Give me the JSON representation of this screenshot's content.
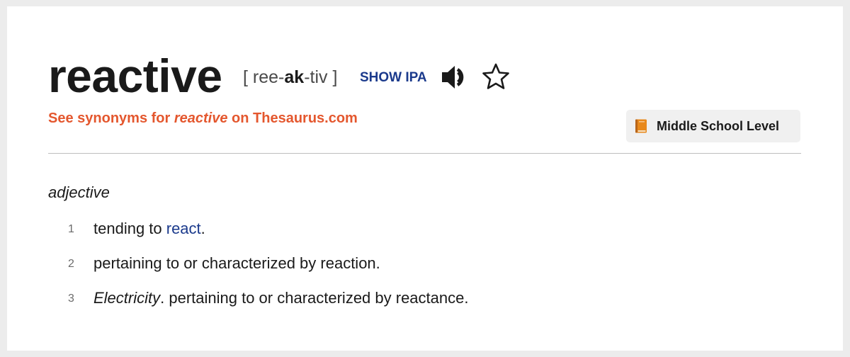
{
  "entry": {
    "headword": "reactive",
    "pronunciation": {
      "open_bracket": "[",
      "syllable_1": "ree-",
      "stressed": "ak",
      "syllable_3": "-tiv",
      "close_bracket": "]"
    },
    "show_ipa_label": "SHOW IPA",
    "audio_icon": "speaker-icon",
    "favorite_icon": "star-outline-icon"
  },
  "synonyms_link": {
    "prefix": "See synonyms for ",
    "word": "reactive",
    "suffix": " on Thesaurus.com"
  },
  "level_badge": {
    "icon": "book-icon",
    "label": "Middle School Level"
  },
  "definitions": {
    "part_of_speech": "adjective",
    "senses": [
      {
        "number": "1",
        "before": "tending to ",
        "link": "react",
        "after": "."
      },
      {
        "number": "2",
        "text": "pertaining to or characterized by reaction."
      },
      {
        "number": "3",
        "label": "Electricity",
        "text": ". pertaining to or characterized by reactance."
      }
    ]
  },
  "colors": {
    "link_blue": "#1b3a8c",
    "synonym_orange": "#e4572e",
    "badge_background": "#f0f0f0",
    "page_background": "#ececec"
  }
}
